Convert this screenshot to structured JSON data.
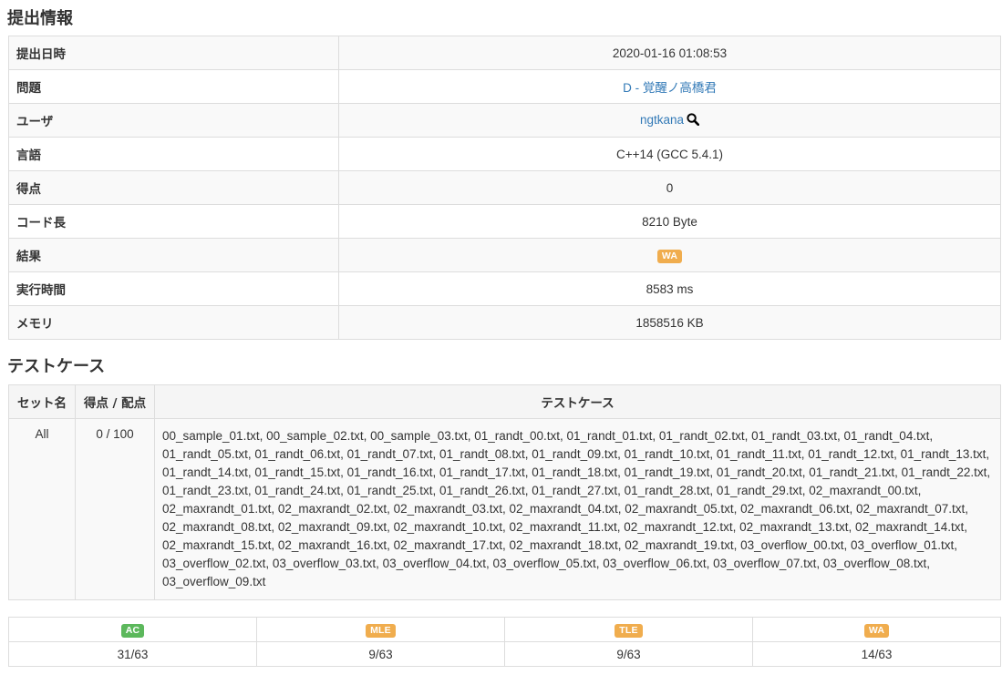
{
  "submission": {
    "heading": "提出情報",
    "rows": {
      "submit_time": {
        "label": "提出日時",
        "value": "2020-01-16 01:08:53"
      },
      "problem": {
        "label": "問題",
        "value": "D - 覚醒ノ高橋君"
      },
      "user": {
        "label": "ユーザ",
        "value": "ngtkana",
        "icon": "search-icon"
      },
      "language": {
        "label": "言語",
        "value": "C++14 (GCC 5.4.1)"
      },
      "score": {
        "label": "得点",
        "value": "0"
      },
      "code_length": {
        "label": "コード長",
        "value": "8210 Byte"
      },
      "result": {
        "label": "結果",
        "value": "WA",
        "color": "#f0ad4e"
      },
      "exec_time": {
        "label": "実行時間",
        "value": "8583 ms"
      },
      "memory": {
        "label": "メモリ",
        "value": "1858516 KB"
      }
    }
  },
  "testcases": {
    "heading": "テストケース",
    "headers": {
      "set": "セット名",
      "score": "得点 / 配点",
      "cases": "テストケース"
    },
    "rows": [
      {
        "set": "All",
        "score": "0 / 100",
        "cases": "00_sample_01.txt, 00_sample_02.txt, 00_sample_03.txt, 01_randt_00.txt, 01_randt_01.txt, 01_randt_02.txt, 01_randt_03.txt, 01_randt_04.txt, 01_randt_05.txt, 01_randt_06.txt, 01_randt_07.txt, 01_randt_08.txt, 01_randt_09.txt, 01_randt_10.txt, 01_randt_11.txt, 01_randt_12.txt, 01_randt_13.txt, 01_randt_14.txt, 01_randt_15.txt, 01_randt_16.txt, 01_randt_17.txt, 01_randt_18.txt, 01_randt_19.txt, 01_randt_20.txt, 01_randt_21.txt, 01_randt_22.txt, 01_randt_23.txt, 01_randt_24.txt, 01_randt_25.txt, 01_randt_26.txt, 01_randt_27.txt, 01_randt_28.txt, 01_randt_29.txt, 02_maxrandt_00.txt, 02_maxrandt_01.txt, 02_maxrandt_02.txt, 02_maxrandt_03.txt, 02_maxrandt_04.txt, 02_maxrandt_05.txt, 02_maxrandt_06.txt, 02_maxrandt_07.txt, 02_maxrandt_08.txt, 02_maxrandt_09.txt, 02_maxrandt_10.txt, 02_maxrandt_11.txt, 02_maxrandt_12.txt, 02_maxrandt_13.txt, 02_maxrandt_14.txt, 02_maxrandt_15.txt, 02_maxrandt_16.txt, 02_maxrandt_17.txt, 02_maxrandt_18.txt, 02_maxrandt_19.txt, 03_overflow_00.txt, 03_overflow_01.txt, 03_overflow_02.txt, 03_overflow_03.txt, 03_overflow_04.txt, 03_overflow_05.txt, 03_overflow_06.txt, 03_overflow_07.txt, 03_overflow_08.txt, 03_overflow_09.txt"
      }
    ]
  },
  "stats": [
    {
      "label": "AC",
      "count": "31/63",
      "color": "#5cb85c"
    },
    {
      "label": "MLE",
      "count": "9/63",
      "color": "#f0ad4e"
    },
    {
      "label": "TLE",
      "count": "9/63",
      "color": "#f0ad4e"
    },
    {
      "label": "WA",
      "count": "14/63",
      "color": "#f0ad4e"
    }
  ]
}
